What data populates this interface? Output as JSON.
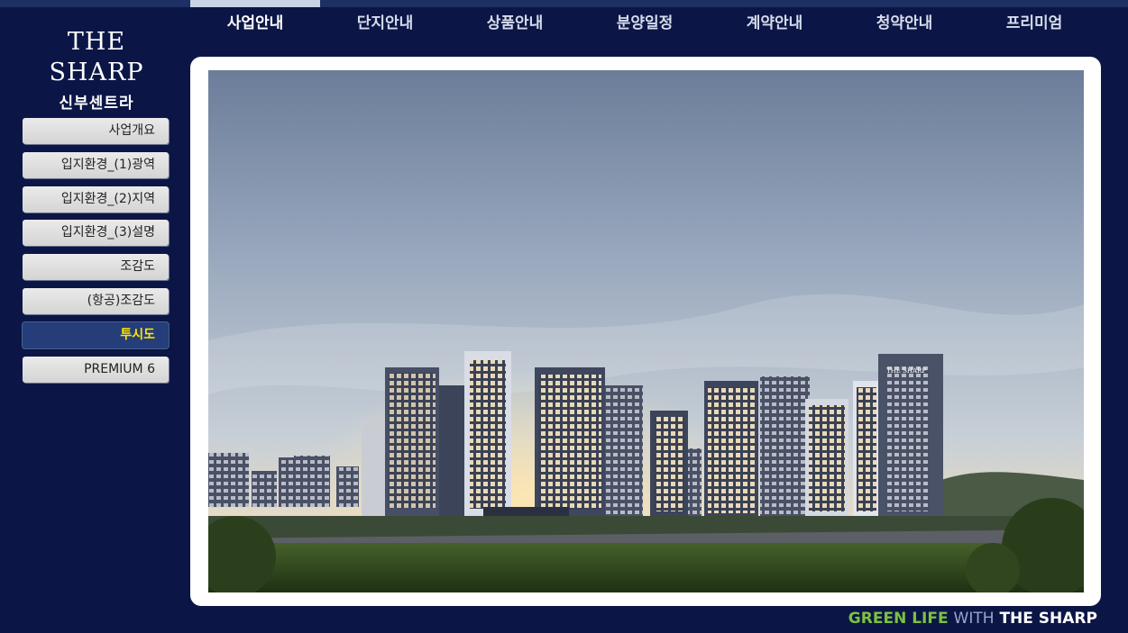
{
  "logo": {
    "brand": "THE SHARP",
    "subtitle": "신부센트라"
  },
  "nav": {
    "tabs": [
      {
        "label": "사업안내",
        "active": true
      },
      {
        "label": "단지안내"
      },
      {
        "label": "상품안내"
      },
      {
        "label": "분양일정"
      },
      {
        "label": "계약안내"
      },
      {
        "label": "청약안내"
      },
      {
        "label": "프리미엄"
      }
    ]
  },
  "sidemenu": {
    "items": [
      {
        "label": "사업개요"
      },
      {
        "label": "입지환경_(1)광역"
      },
      {
        "label": "입지환경_(2)지역"
      },
      {
        "label": "입지환경_(3)설명"
      },
      {
        "label": "조감도"
      },
      {
        "label": "(항공)조감도"
      },
      {
        "label": "투시도",
        "active": true
      },
      {
        "label": "PREMIUM 6"
      }
    ]
  },
  "main": {
    "image": "apartment-perspective-rendering"
  },
  "slogan": {
    "part1": "GREEN LIFE",
    "part2": "WITH",
    "part3": "THE SHARP"
  },
  "colors": {
    "background": "#0b1646",
    "active_menu": "#253d78",
    "active_menu_text": "#ffe600",
    "slogan_green": "#7cc23e"
  }
}
